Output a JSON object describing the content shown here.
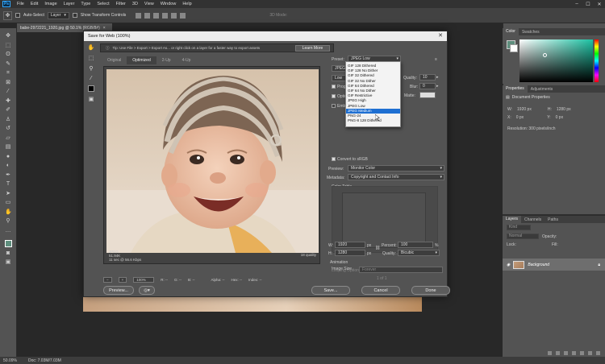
{
  "app": {
    "logo": "Ps",
    "menus": [
      "File",
      "Edit",
      "Image",
      "Layer",
      "Type",
      "Select",
      "Filter",
      "3D",
      "View",
      "Window",
      "Help"
    ],
    "window_controls": [
      "–",
      "☐",
      "✕"
    ]
  },
  "options_bar": {
    "auto_select_label": "Auto-Select",
    "auto_select_mode": "Layer",
    "transform_label": "Show Transform Controls",
    "mode_3d_label": "3D Mode:"
  },
  "document_tab": {
    "title": "babe-2972221_1920.jpg @ 50.1% (RGB/8#)",
    "close": "×"
  },
  "status_bar": {
    "zoom": "50.09%",
    "doc": "Doc: 7.03M/7.03M"
  },
  "color_panel": {
    "tabs": [
      "Color",
      "Swatches"
    ],
    "fg_color": "#5e8e7d"
  },
  "properties_panel": {
    "tabs": [
      "Properties",
      "Adjustments"
    ],
    "title": "Document Properties",
    "w_label": "W:",
    "w_value": "1920 px",
    "h_label": "H:",
    "h_value": "1280 px",
    "x_label": "X:",
    "x_value": "0 px",
    "y_label": "Y:",
    "y_value": "0 px",
    "resolution": "Resolution: 300 pixels/inch"
  },
  "layers_panel": {
    "tabs": [
      "Layers",
      "Channels",
      "Paths"
    ],
    "kind": "Kind",
    "blend": "Normal",
    "opacity_label": "Opacity:",
    "lock_label": "Lock:",
    "fill_label": "Fill:",
    "layer_name": "Background"
  },
  "dialog": {
    "title": "Save for Web (100%)",
    "close": "✕",
    "tip": "Tip: Use File > Export > Export As... or right click on a layer for a faster way to export assets",
    "learn_more": "Learn More",
    "view_tabs": [
      "Original",
      "Optimized",
      "2-Up",
      "4-Up"
    ],
    "image_info": {
      "format": "JPEG",
      "size": "51.94K",
      "time": "11 sec @ 56.6 Kbps",
      "quality": "18 quality"
    },
    "bottom": {
      "zoom": "100%",
      "r": "R: --",
      "g": "G: --",
      "b": "B: --",
      "alpha": "Alpha: --",
      "hex": "Hex: --",
      "index": "Index: --"
    },
    "buttons": {
      "preview": "Preview...",
      "save": "Save...",
      "cancel": "Cancel",
      "done": "Done"
    },
    "settings": {
      "preset_label": "Preset:",
      "preset_value": "JPEG Low",
      "format_value": "JPEG",
      "quality_level": "Low",
      "quality_label": "Quality:",
      "quality_value": "10",
      "blur_label": "Blur:",
      "blur_value": "0",
      "matte_label": "Matte:",
      "progressive_label": "Progressive",
      "optimized_label": "Optimized",
      "embed_label": "Embed Color Profile",
      "convert_label": "Convert to sRGB",
      "preview_label": "Preview:",
      "preview_value": "Monitor Color",
      "metadata_label": "Metadata:",
      "metadata_value": "Copyright and Contact Info",
      "color_table": "Color Table",
      "image_size": "Image Size",
      "w_label": "W:",
      "w_value": "1920",
      "h_label": "H:",
      "h_value": "1280",
      "px": "px",
      "percent_label": "Percent:",
      "percent_value": "100",
      "pct": "%",
      "isize_quality_label": "Quality:",
      "isize_quality_value": "Bicubic",
      "animation": "Animation",
      "looping_label": "Looping Options:",
      "looping_value": "Forever",
      "frames": "1 of 1"
    },
    "preset_dropdown": [
      "GIF 128 Dithered",
      "GIF 128 No Dither",
      "GIF 32 Dithered",
      "GIF 32 No Dither",
      "GIF 64 Dithered",
      "GIF 64 No Dither",
      "GIF Restrictive",
      "JPEG High",
      "JPEG Low",
      "JPEG Medium",
      "PNG-24",
      "PNG-8 128 Dithered"
    ],
    "preset_dropdown_selected": "JPEG Medium"
  }
}
